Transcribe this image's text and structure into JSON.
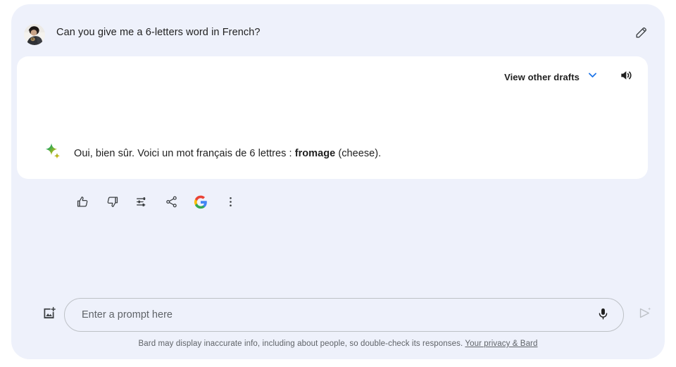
{
  "theme": {
    "page_background": "#eef1fb",
    "card_background": "#ffffff",
    "text_primary": "#1f1f1f",
    "text_secondary": "#5f6368",
    "accent_blue": "#1a73e8",
    "border": "#bdc1c6",
    "disabled_icon": "#bdc1c6"
  },
  "conversation": {
    "user_message": {
      "avatar_icon": "user-photo-avatar",
      "text": "Can you give me a 6-letters word in French?",
      "edit_icon": "pencil-icon"
    },
    "response": {
      "bard_icon": "bard-sparkle-icon",
      "drafts_label": "View other drafts",
      "drafts_chevron_icon": "chevron-down-icon",
      "speaker_icon": "volume-up-icon",
      "text_before": "Oui, bien sûr. Voici un mot français de 6 lettres : ",
      "text_bold": "fromage",
      "text_after": " (cheese).",
      "actions": [
        {
          "name": "thumb-up",
          "icon": "thumb-up-icon"
        },
        {
          "name": "thumb-down",
          "icon": "thumb-down-icon"
        },
        {
          "name": "modify-response",
          "icon": "tune-icon"
        },
        {
          "name": "share",
          "icon": "share-icon"
        },
        {
          "name": "google-it",
          "icon": "google-g-icon"
        },
        {
          "name": "more-options",
          "icon": "more-vert-icon"
        }
      ]
    }
  },
  "composer": {
    "add_image_icon": "add-image-icon",
    "input_value": "",
    "input_placeholder": "Enter a prompt here",
    "mic_icon": "microphone-icon",
    "send_icon": "send-sparkle-icon"
  },
  "footer": {
    "disclaimer": "Bard may display inaccurate info, including about people, so double-check its responses.",
    "link_label": "Your privacy & Bard"
  }
}
